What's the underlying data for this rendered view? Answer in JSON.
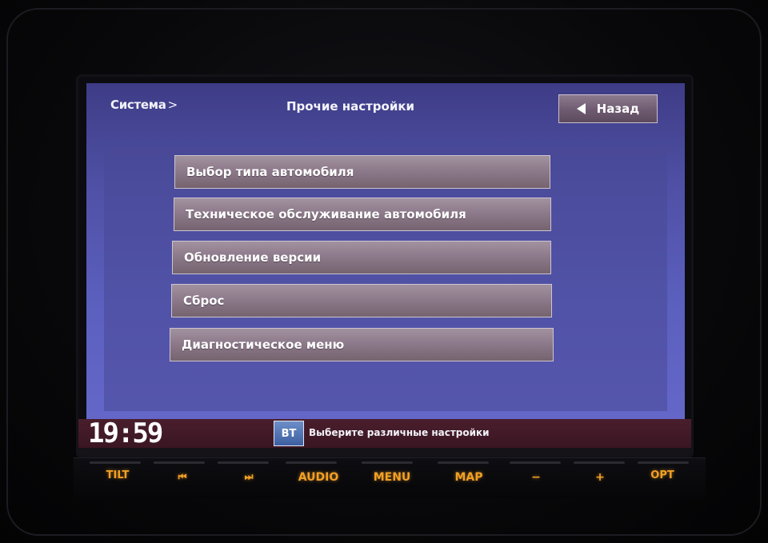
{
  "header": {
    "breadcrumb": "Система",
    "breadcrumb_chevron": ">",
    "title": "Прочие настройки",
    "back_label": "Назад"
  },
  "menu": {
    "items": [
      {
        "label": "Выбор типа автомобиля"
      },
      {
        "label": "Техническое обслуживание автомобиля"
      },
      {
        "label": "Обновление версии"
      },
      {
        "label": "Сброс"
      },
      {
        "label": "Диагностическое меню"
      }
    ]
  },
  "status": {
    "time": "19:59",
    "bt_label": "BT",
    "hint": "Выберите различные настройки"
  },
  "hardware_buttons": {
    "tilt": "TILT",
    "prev": "⏮",
    "next": "⏭",
    "audio": "AUDIO",
    "menu": "MENU",
    "map": "MAP",
    "minus": "−",
    "plus": "+",
    "opt": "OPT"
  },
  "colors": {
    "screen_bg": "#5b5fbd",
    "button_face": "#8d7a8b",
    "status_bar": "#4a1e2c",
    "hardware_key": "#f2a025"
  },
  "icons": {
    "back": "triangle-left-icon",
    "prev": "skip-back-icon",
    "next": "skip-forward-icon"
  }
}
